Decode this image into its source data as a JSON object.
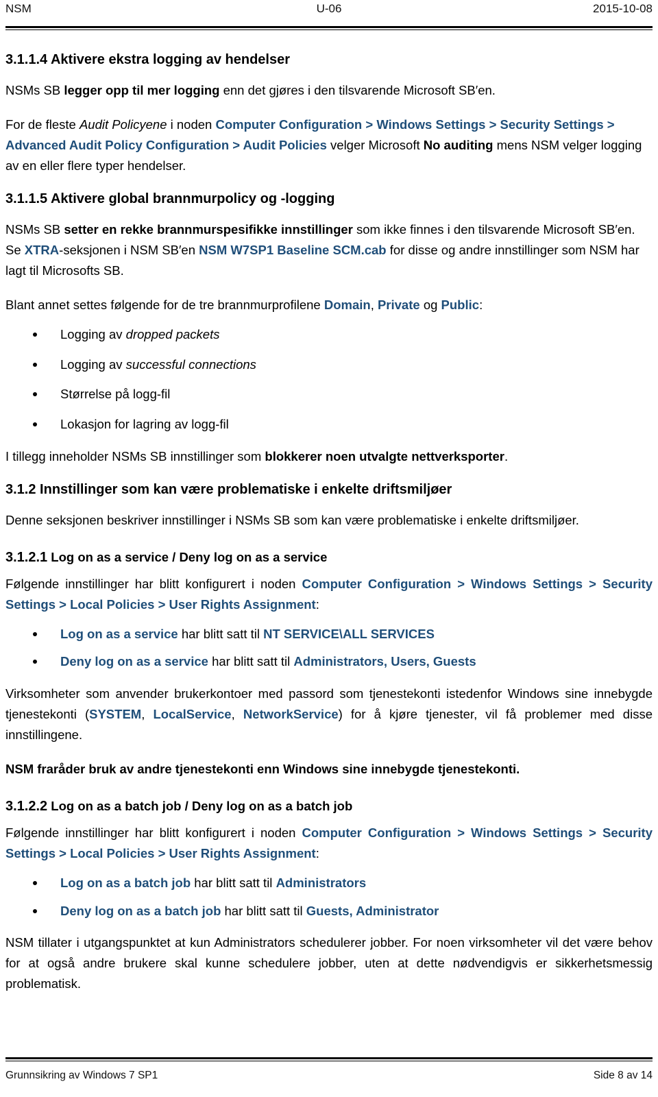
{
  "header": {
    "left": "NSM",
    "center": "U-06",
    "right": "2015-10-08"
  },
  "footer": {
    "left": "Grunnsikring av Windows 7 SP1",
    "right": "Side 8 av 14"
  },
  "colors": {
    "accent_blue": "#1F4E79",
    "text_black": "#000000"
  },
  "sections": {
    "s3114": {
      "heading": "3.1.1.4 Aktivere ekstra logging av hendelser",
      "p1": {
        "a": "NSMs SB ",
        "b_bold": "legger opp til mer logging",
        "c": " enn det gjøres i den tilsvarende Microsoft SB′en."
      },
      "p2": {
        "a": "For de fleste ",
        "b_italic": "Audit Policyene",
        "c": " i noden ",
        "d_blue": "Computer Configuration > Windows Settings > Security Settings > Advanced Audit Policy Configuration > Audit Policies",
        "e": " velger Microsoft ",
        "f_bold": "No auditing",
        "g": " mens NSM velger logging av en eller flere typer hendelser."
      }
    },
    "s3115": {
      "heading": "3.1.1.5 Aktivere global brannmurpolicy og -logging",
      "p1": {
        "a": "NSMs SB ",
        "b_bold": "setter en rekke brannmurspesifikke innstillinger",
        "c": " som ikke finnes i den tilsvarende Microsoft SB′en. Se ",
        "d_blue": "XTRA",
        "e": "-seksjonen i NSM SB′en ",
        "f_blue": "NSM W7SP1 Baseline SCM.cab",
        "g": " for disse og andre innstillinger som NSM har lagt til Microsofts SB."
      },
      "p2": {
        "a": "Blant annet settes følgende for de tre brannmurprofilene ",
        "b_blue": "Domain",
        "c": ", ",
        "d_blue": "Private",
        "e": " og ",
        "f_blue": "Public",
        "g": ":"
      },
      "bullets": [
        {
          "lead": "Logging av ",
          "italic": "dropped packets",
          "tail": ""
        },
        {
          "lead": "Logging av ",
          "italic": "successful connections",
          "tail": ""
        },
        {
          "lead": "Størrelse på logg-fil",
          "italic": "",
          "tail": ""
        },
        {
          "lead": "Lokasjon for lagring av logg-fil",
          "italic": "",
          "tail": ""
        }
      ],
      "p3": {
        "a": "I tillegg inneholder NSMs SB innstillinger som ",
        "b_bold": "blokkerer noen utvalgte nettverksporter",
        "c": "."
      }
    },
    "s312": {
      "heading": "3.1.2 Innstillinger som kan være problematiske i enkelte driftsmiljøer",
      "p1": "Denne seksjonen beskriver innstillinger i NSMs SB som kan være problematiske i enkelte driftsmiljøer."
    },
    "s3121": {
      "heading_num": "3.1.2.1",
      "heading_text": " Log on as a service / Deny log on as a service",
      "p1": {
        "a": "Følgende innstillinger har blitt konfigurert i noden ",
        "b_blue": "Computer Configuration > Windows Settings > Security Settings > Local Policies > User Rights Assignment",
        "c": ":"
      },
      "bullets": [
        {
          "name": "Log on as a service",
          "mid": " har blitt satt til ",
          "value": "NT SERVICE\\ALL SERVICES"
        },
        {
          "name": "Deny log on as a service",
          "mid": " har blitt satt til ",
          "value": "Administrators, Users, Guests"
        }
      ],
      "p2": {
        "a": "Virksomheter som anvender brukerkontoer med passord som tjenestekonti istedenfor Windows sine innebygde tjenestekonti (",
        "b_blue": "SYSTEM",
        "c": ", ",
        "d_blue": "LocalService",
        "e": ", ",
        "f_blue": "NetworkService",
        "g": ") for å kjøre tjenester, vil få problemer med disse innstillingene."
      },
      "p3_bold": "NSM fraråder bruk av andre tjenestekonti enn Windows sine innebygde tjenestekonti."
    },
    "s3122": {
      "heading_num": "3.1.2.2",
      "heading_text": " Log on as a batch job / Deny log on as a batch job",
      "p1": {
        "a": "Følgende innstillinger har blitt konfigurert i noden ",
        "b_blue": "Computer Configuration > Windows Settings > Security Settings > Local Policies > User Rights Assignment",
        "c": ":"
      },
      "bullets": [
        {
          "name": "Log on as a batch job",
          "mid": " har blitt satt til ",
          "value": "Administrators"
        },
        {
          "name": "Deny log on as a batch job",
          "mid": " har blitt satt til ",
          "value": "Guests, Administrator"
        }
      ],
      "p2": "NSM tillater i utgangspunktet at kun Administrators schedulerer jobber. For noen virksomheter vil det være behov for at også andre brukere skal kunne schedulere jobber, uten at dette nødvendigvis er sikkerhetsmessig problematisk."
    }
  }
}
